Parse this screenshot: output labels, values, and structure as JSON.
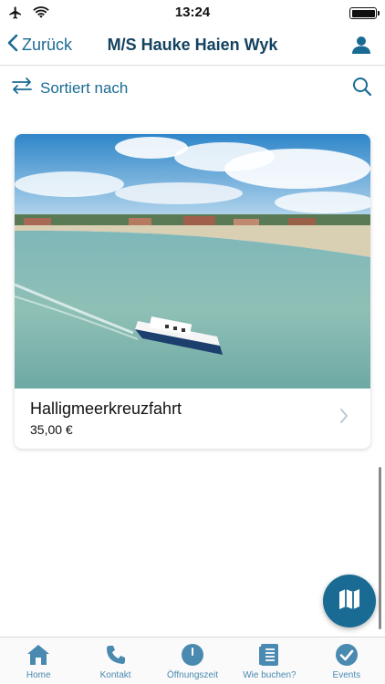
{
  "status_bar": {
    "time": "13:24"
  },
  "nav": {
    "back_label": "Zurück",
    "title": "M/S Hauke Haien Wyk"
  },
  "sort": {
    "label": "Sortiert nach"
  },
  "tours": [
    {
      "title": "Halligmeerkreuzfahrt",
      "price": "35,00 €"
    }
  ],
  "tab_bar": {
    "items": [
      {
        "label": "Home",
        "icon": "home-icon"
      },
      {
        "label": "Kontakt",
        "icon": "phone-icon"
      },
      {
        "label": "Öffnungszeit",
        "icon": "clock-icon"
      },
      {
        "label": "Wie buchen?",
        "icon": "document-icon"
      },
      {
        "label": "Events",
        "icon": "checkmark-icon"
      }
    ]
  },
  "colors": {
    "accent": "#1a6b94",
    "title": "#14425f",
    "tab_label": "#4a8ab0"
  }
}
